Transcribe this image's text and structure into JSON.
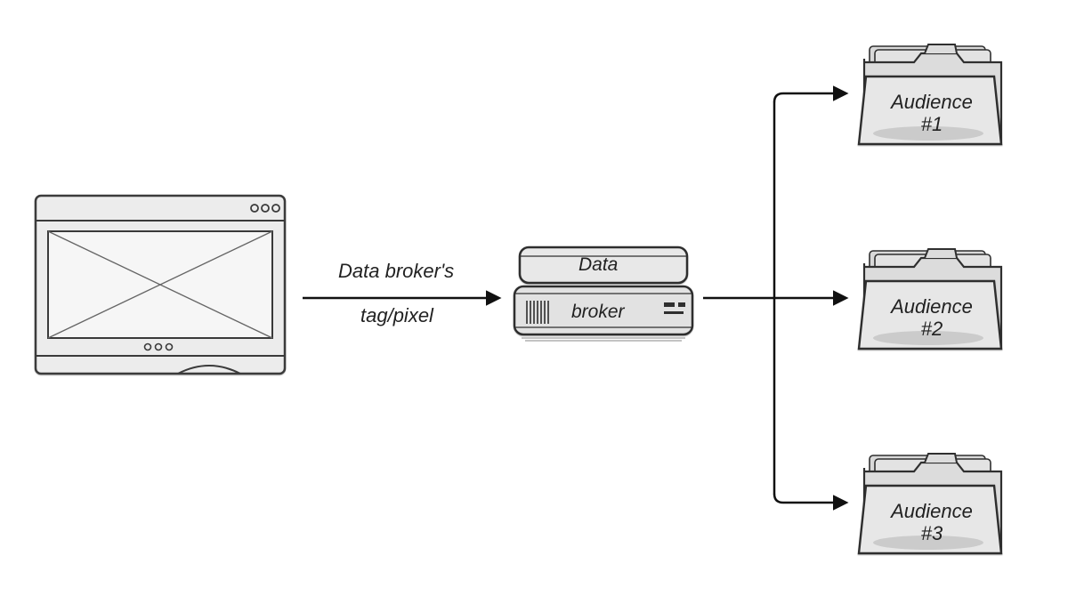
{
  "diagram": {
    "source": {
      "kind": "browser-window"
    },
    "arrow1": {
      "label_top": "Data broker's",
      "label_bottom": "tag/pixel"
    },
    "middle": {
      "kind": "server-stack",
      "label_top": "Data",
      "label_bottom": "broker"
    },
    "destinations": [
      {
        "label_line1": "Audience",
        "label_line2": "#1"
      },
      {
        "label_line1": "Audience",
        "label_line2": "#2"
      },
      {
        "label_line1": "Audience",
        "label_line2": "#3"
      }
    ]
  }
}
